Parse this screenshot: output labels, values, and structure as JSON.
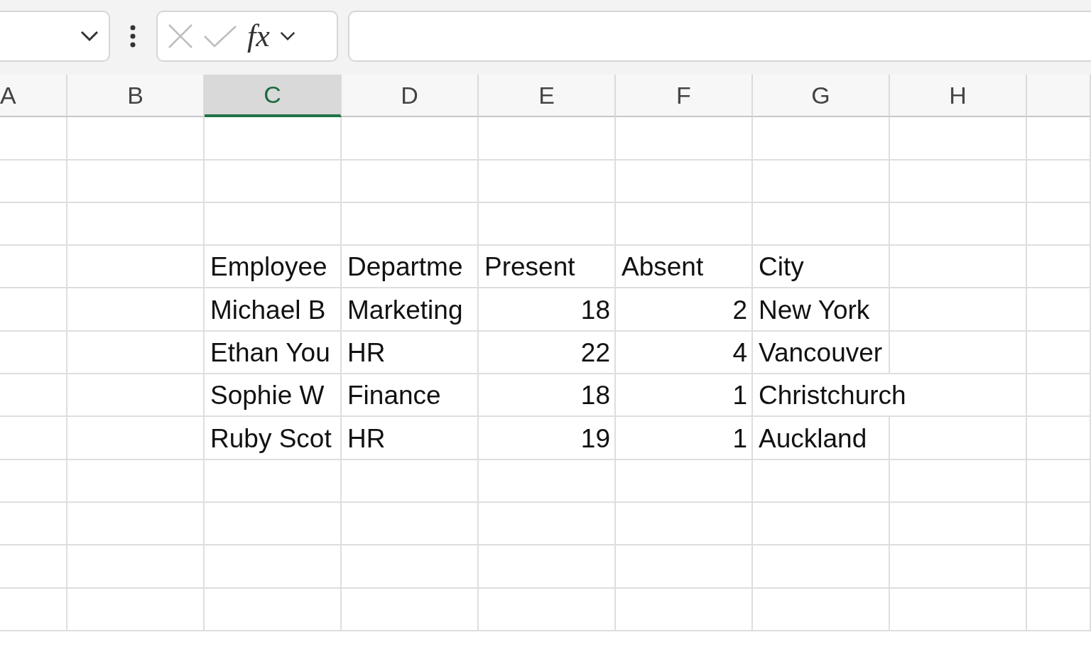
{
  "formula_bar": {
    "function_label": "fx",
    "cancel_disabled": true,
    "enter_disabled": true
  },
  "columns": [
    {
      "label": "A",
      "selected": false
    },
    {
      "label": "B",
      "selected": false
    },
    {
      "label": "C",
      "selected": true
    },
    {
      "label": "D",
      "selected": false
    },
    {
      "label": "E",
      "selected": false
    },
    {
      "label": "F",
      "selected": false
    },
    {
      "label": "G",
      "selected": false
    },
    {
      "label": "H",
      "selected": false
    }
  ],
  "table": {
    "header": [
      "Employee",
      "Departme",
      "Present",
      "Absent",
      "City"
    ],
    "rows": [
      [
        {
          "kind": "text",
          "text": "Michael B"
        },
        {
          "kind": "text",
          "text": "Marketing"
        },
        {
          "kind": "number",
          "text": "18"
        },
        {
          "kind": "number",
          "text": "2"
        },
        {
          "kind": "text",
          "text": "New York"
        }
      ],
      [
        {
          "kind": "text",
          "text": "Ethan You"
        },
        {
          "kind": "text",
          "text": "HR"
        },
        {
          "kind": "number",
          "text": "22"
        },
        {
          "kind": "number",
          "text": "4"
        },
        {
          "kind": "text",
          "text": "Vancouver"
        }
      ],
      [
        {
          "kind": "text",
          "text": "Sophie W"
        },
        {
          "kind": "text",
          "text": "Finance"
        },
        {
          "kind": "number",
          "text": "18"
        },
        {
          "kind": "number",
          "text": "1"
        },
        {
          "kind": "text",
          "text": "Christchurch"
        }
      ],
      [
        {
          "kind": "text",
          "text": "Ruby Scot"
        },
        {
          "kind": "text",
          "text": "HR"
        },
        {
          "kind": "number",
          "text": "19"
        },
        {
          "kind": "number",
          "text": "1"
        },
        {
          "kind": "text",
          "text": "Auckland"
        }
      ]
    ]
  }
}
